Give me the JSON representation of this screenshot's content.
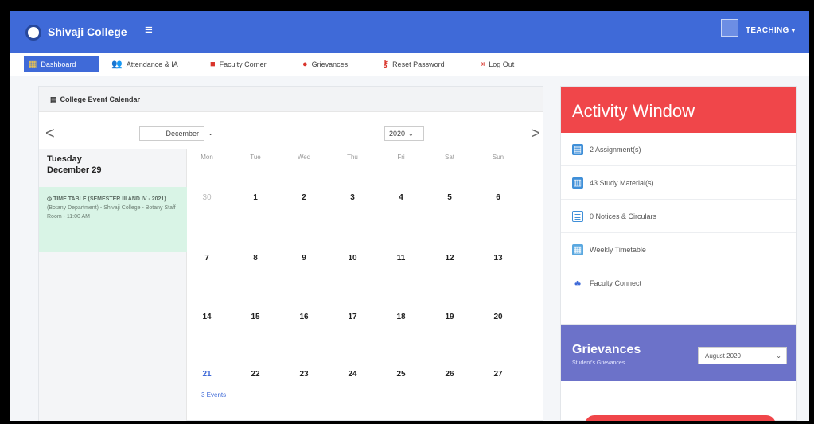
{
  "header": {
    "brand": "Shivaji College",
    "user_role": "TEACHING",
    "menu_icon": "hamburger-icon",
    "user_caret": "▾"
  },
  "nav": {
    "items": [
      {
        "label": "Dashboard",
        "icon": "dashboard-icon"
      },
      {
        "label": "Attendance & IA",
        "icon": "users-icon"
      },
      {
        "label": "Faculty Corner",
        "icon": "book-icon"
      },
      {
        "label": "Grievances",
        "icon": "alert-circle-icon"
      },
      {
        "label": "Reset Password",
        "icon": "key-icon"
      },
      {
        "label": "Log Out",
        "icon": "logout-icon"
      }
    ]
  },
  "calendar": {
    "title": "College Event Calendar",
    "month": "December",
    "year": "2020",
    "selected_weekday": "Tuesday",
    "selected_date": "December 29",
    "event_title": "TIME TABLE (SEMESTER III AND IV - 2021)",
    "event_detail": "(Botany Department) - Shivaji College - Botany Staff Room - 11:00 AM",
    "weekdays": [
      "Mon",
      "Tue",
      "Wed",
      "Thu",
      "Fri",
      "Sat",
      "Sun"
    ],
    "weeks": [
      [
        "30",
        "1",
        "2",
        "3",
        "4",
        "5",
        "6"
      ],
      [
        "7",
        "8",
        "9",
        "10",
        "11",
        "12",
        "13"
      ],
      [
        "14",
        "15",
        "16",
        "17",
        "18",
        "19",
        "20"
      ],
      [
        "21",
        "22",
        "23",
        "24",
        "25",
        "26",
        "27"
      ]
    ],
    "events_link": "3 Events",
    "prev": "<",
    "next": ">"
  },
  "activity": {
    "title": "Activity Window",
    "items": [
      {
        "label": "2 Assignment(s)",
        "icon": "file-icon"
      },
      {
        "label": "43 Study Material(s)",
        "icon": "book-icon"
      },
      {
        "label": "0 Notices & Circulars",
        "icon": "notice-icon"
      },
      {
        "label": "Weekly Timetable",
        "icon": "calendar-icon"
      },
      {
        "label": "Faculty Connect",
        "icon": "org-chart-icon"
      }
    ]
  },
  "grievances": {
    "title": "Grievances",
    "subtitle": "Student's Grievances",
    "selected_month": "August 2020"
  },
  "colors": {
    "primary": "#3f6ad8",
    "activity_header": "#f0464a",
    "grievances_header": "#6c72c9",
    "event_bg": "#d9f4e6"
  }
}
